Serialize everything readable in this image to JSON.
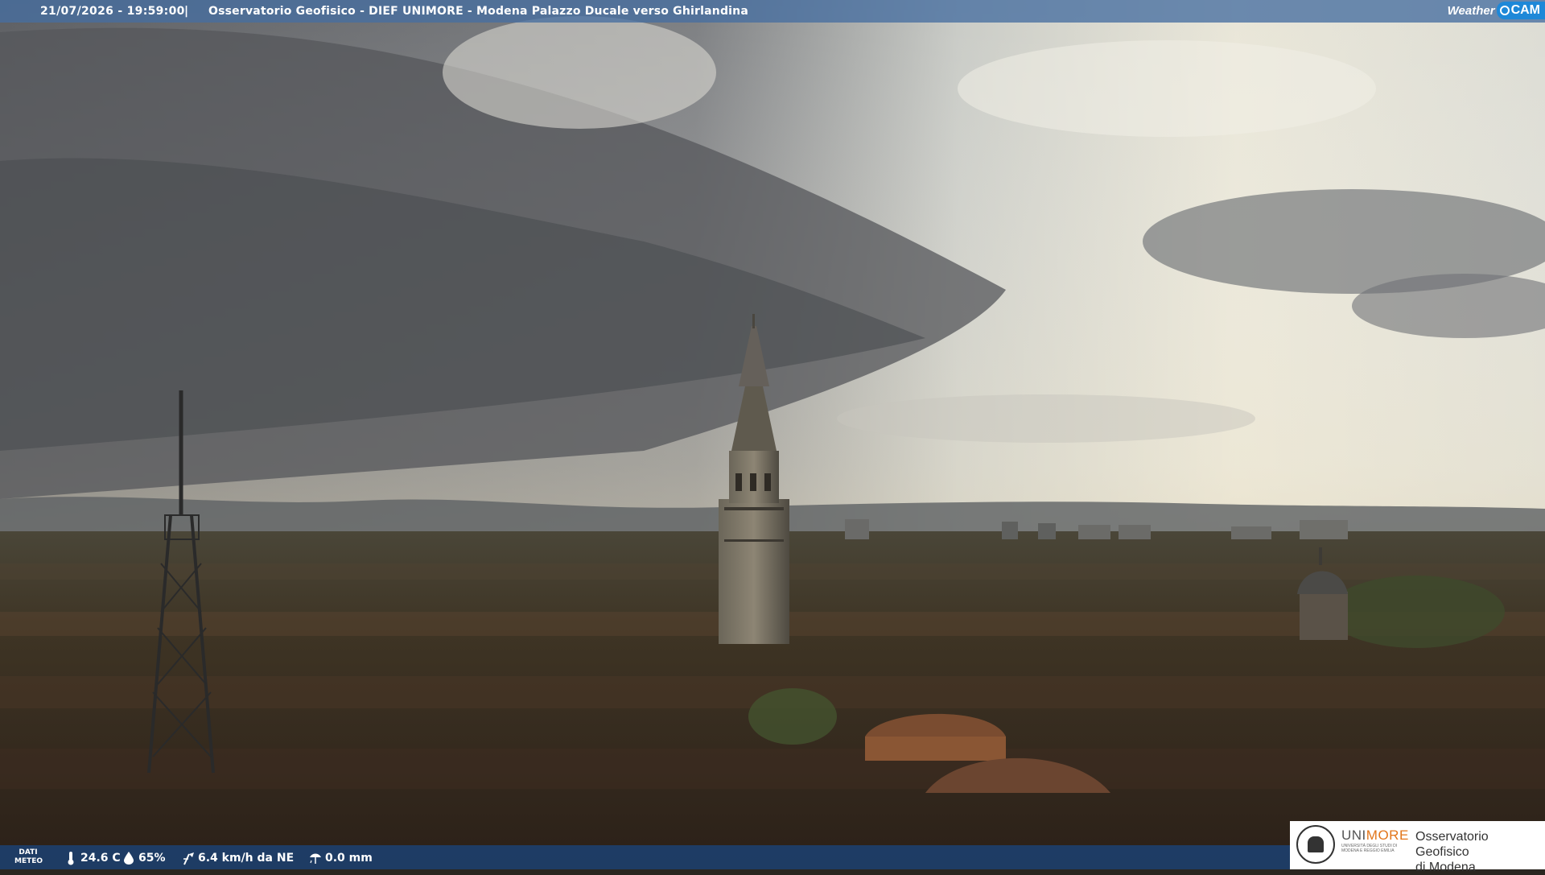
{
  "header": {
    "datetime": "21/07/2026 - 19:59:00",
    "separator": "|",
    "caption": "Osservatorio Geofisico - DIEF UNIMORE - Modena Palazzo Ducale verso Ghirlandina",
    "brand_weather": "Weather",
    "brand_cam": "CAM"
  },
  "weather": {
    "label_line1": "DATI",
    "label_line2": "METEO",
    "temperature": "24.6 C",
    "humidity": "65%",
    "wind": "6.4 km/h da NE",
    "rain": "0.0 mm",
    "icons": [
      "thermometer-icon",
      "drop-icon",
      "wind-icon",
      "rain-gauge-icon"
    ]
  },
  "logo": {
    "university": "UNIMORE",
    "university_prefix": "UNI",
    "university_suffix": "MORE",
    "university_sub": "UNIVERSITÀ DEGLI STUDI DI MODENA E REGGIO EMILIA",
    "observatory_line1": "Osservatorio Geofisico",
    "observatory_line2": "di Modena"
  },
  "colors": {
    "accent_orange": "#e2751a",
    "brand_blue": "#1e88d8"
  }
}
